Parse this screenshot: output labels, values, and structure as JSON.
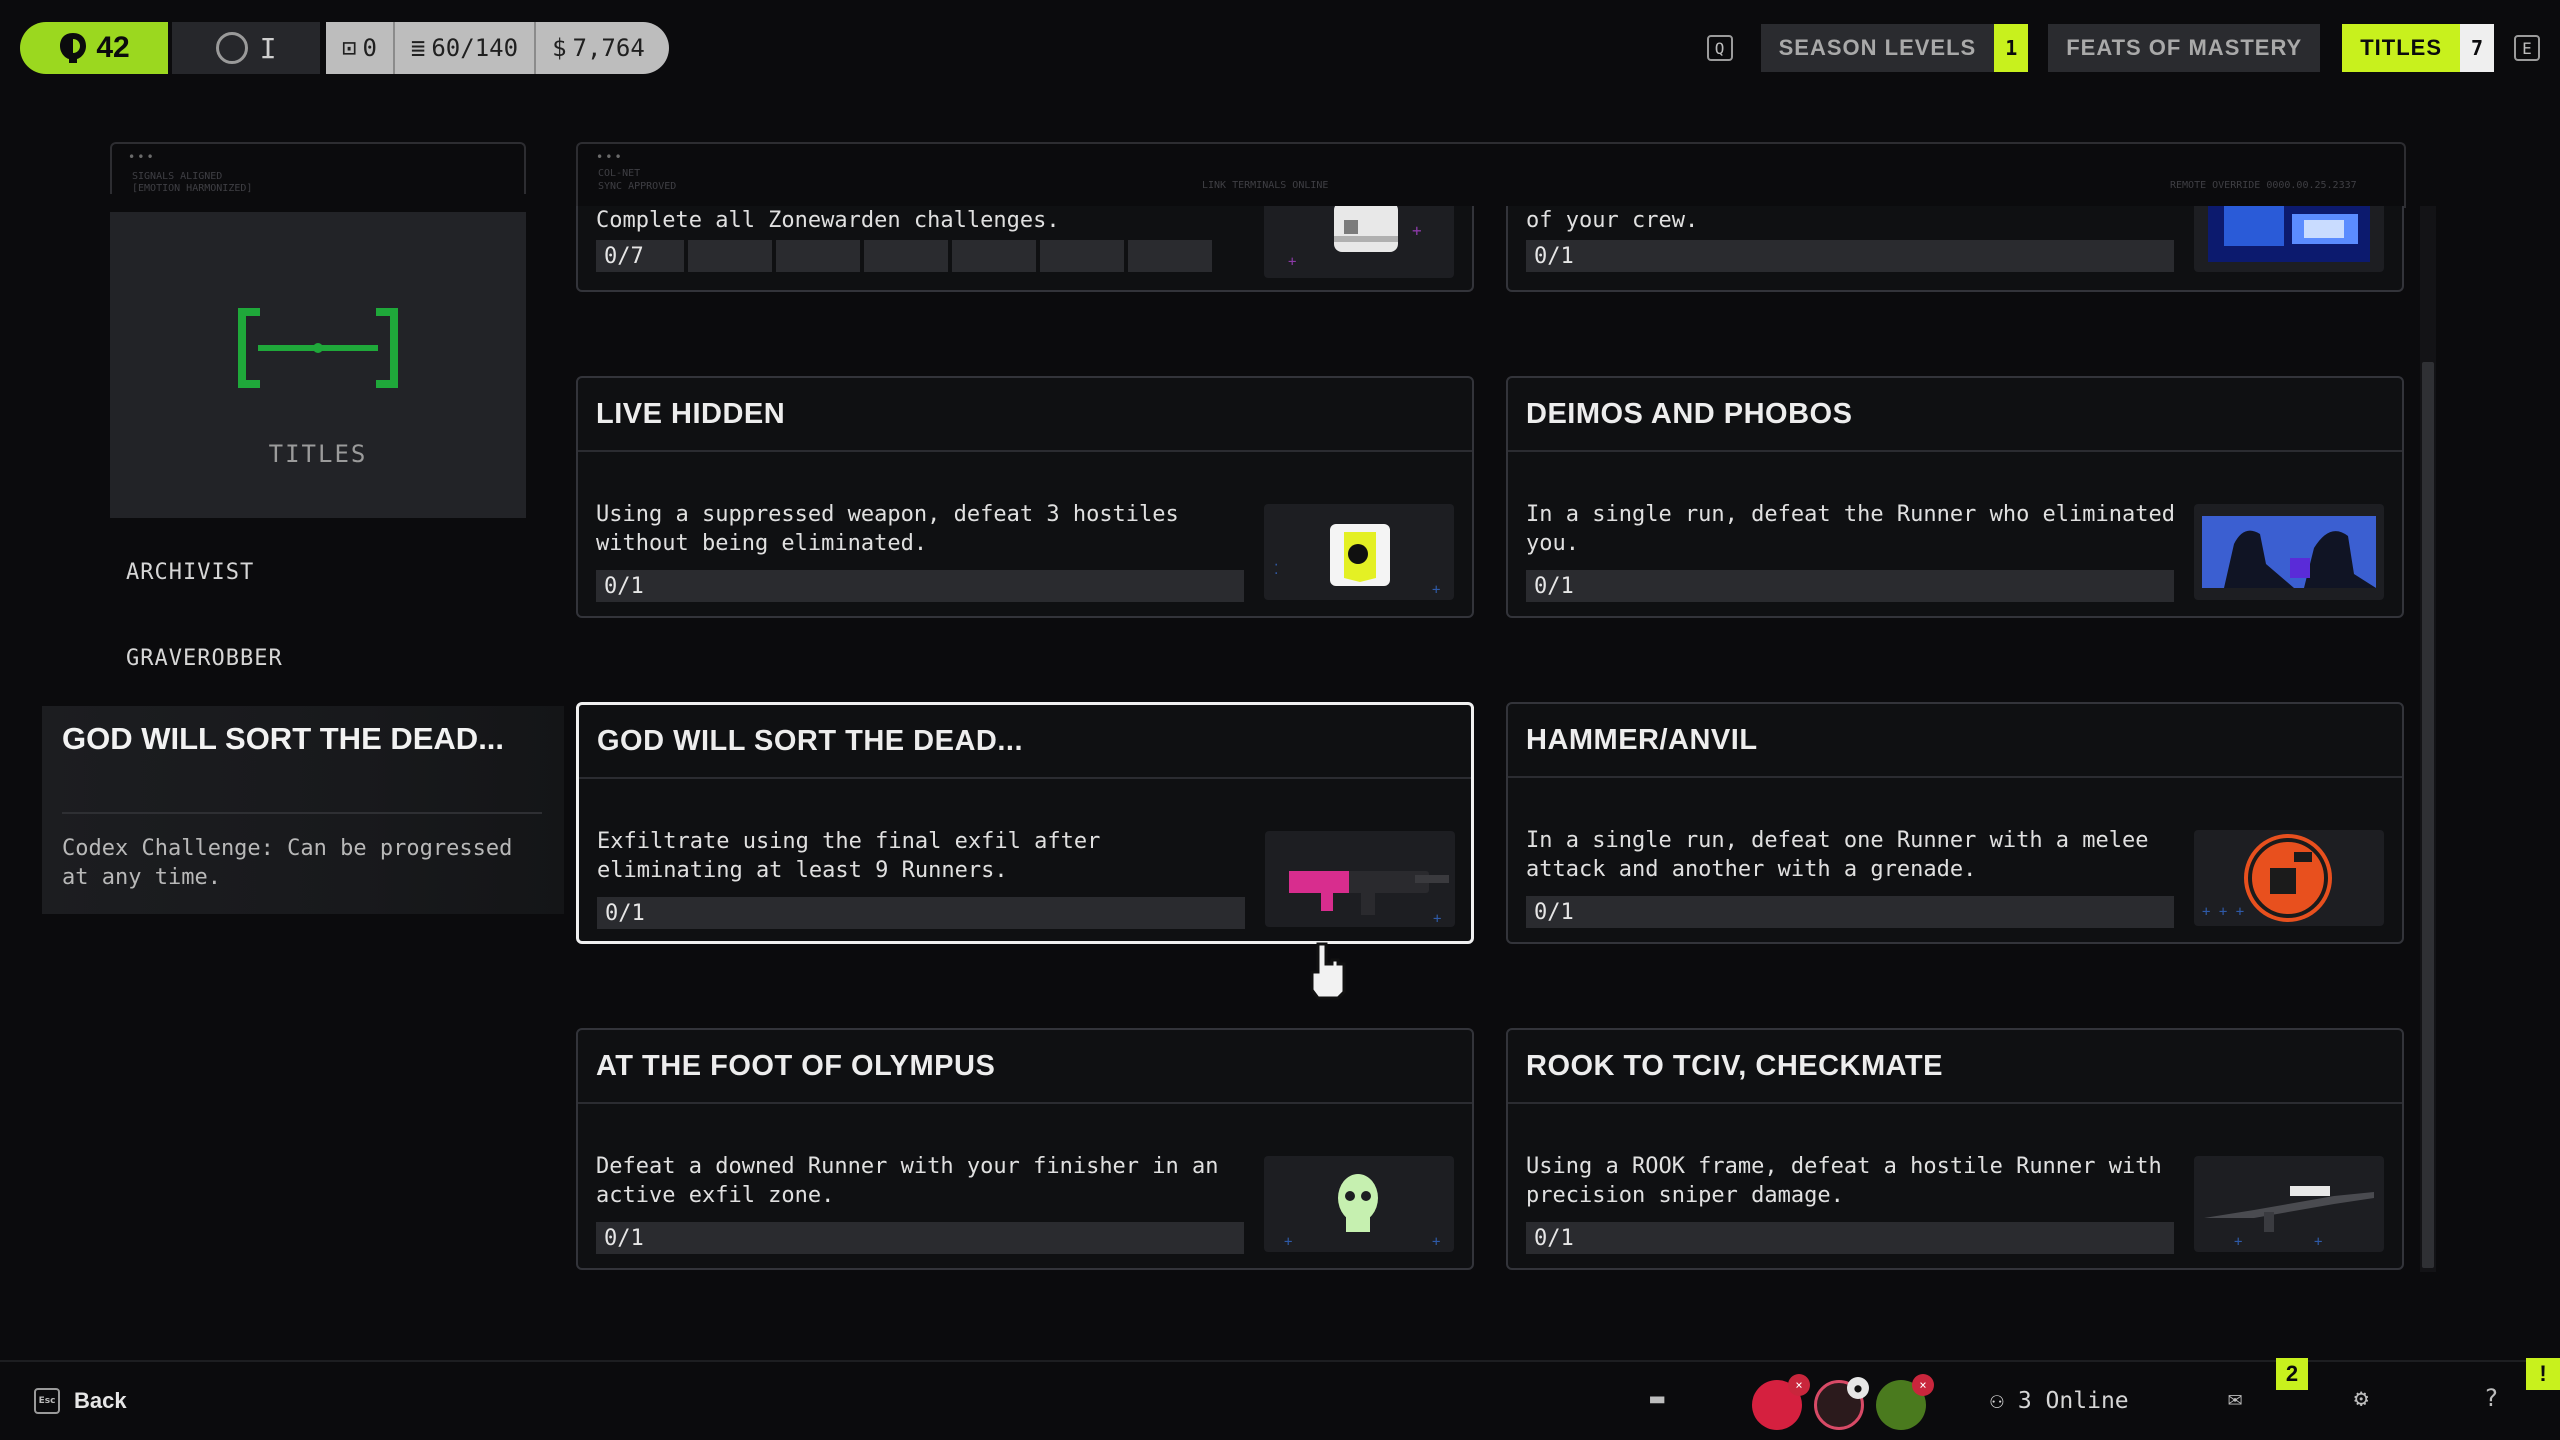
{
  "topbar": {
    "level": "42",
    "rank_label": "I",
    "stats": [
      {
        "icon": "crate-icon",
        "value": "0"
      },
      {
        "icon": "stack-icon",
        "value": "60/140"
      },
      {
        "icon": "credits-icon",
        "value": "7,764"
      }
    ],
    "key_left": "Q",
    "key_right": "E",
    "tabs": [
      {
        "label": "SEASON LEVELS",
        "count": "1"
      },
      {
        "label": "FEATS OF MASTERY",
        "count": ""
      },
      {
        "label": "TITLES",
        "count": "7"
      }
    ]
  },
  "left": {
    "header_tiny": [
      "SIGNALS ALIGNED",
      "[EMOTION HARMONIZED]"
    ],
    "card_label": "TITLES",
    "items": [
      "ARCHIVIST",
      "GRAVEROBBER"
    ],
    "selected": {
      "title": "GOD WILL SORT THE DEAD...",
      "description": "Codex Challenge: Can be progressed at any time."
    }
  },
  "grid_header": {
    "tiny_left": [
      "COL-NET",
      "SYNC APPROVED"
    ],
    "tiny_mid": "LINK TERMINALS ONLINE",
    "tiny_right": "REMOTE OVERRIDE 0000.00.25.2337"
  },
  "challenges": [
    {
      "title": "",
      "description": "Complete all Zonewarden challenges.",
      "progress": "0/7",
      "segments": 7
    },
    {
      "title": "",
      "description": "of your crew.",
      "progress": "0/1"
    },
    {
      "title": "LIVE HIDDEN",
      "description": "Using a suppressed weapon, defeat 3 hostiles without being eliminated.",
      "progress": "0/1"
    },
    {
      "title": "DEIMOS AND PHOBOS",
      "description": "In a single run, defeat the Runner who eliminated you.",
      "progress": "0/1"
    },
    {
      "title": "GOD WILL SORT THE DEAD...",
      "description": "Exfiltrate using the final exfil after eliminating at least 9 Runners.",
      "progress": "0/1"
    },
    {
      "title": "HAMMER/ANVIL",
      "description": "In a single run, defeat one Runner with a melee attack and another with a grenade.",
      "progress": "0/1"
    },
    {
      "title": "AT THE FOOT OF OLYMPUS",
      "description": "Defeat a downed Runner with your finisher in an active exfil zone.",
      "progress": "0/1"
    },
    {
      "title": "ROOK TO TCIV, CHECKMATE",
      "description": "Using a ROOK frame, defeat a hostile Runner with precision sniper damage.",
      "progress": "0/1"
    }
  ],
  "bottombar": {
    "back_key": "Esc",
    "back_label": "Back",
    "online": "3 Online",
    "mail_count": "2",
    "alert": "!"
  },
  "colors": {
    "accent": "#c8f11d",
    "level_green": "#9bd81f",
    "bracket_green": "#1fa83a"
  }
}
